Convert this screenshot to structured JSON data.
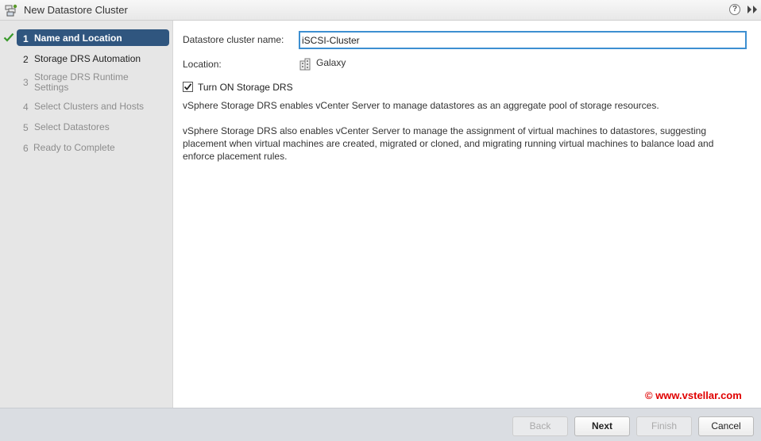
{
  "window": {
    "title": "New Datastore Cluster",
    "title_icon": "datastore-cluster-icon",
    "help_symbol": "?"
  },
  "steps": [
    {
      "number": "1",
      "label": "Name and Location",
      "state": "active",
      "completed": true
    },
    {
      "number": "2",
      "label": "Storage DRS Automation",
      "state": "current"
    },
    {
      "number": "3",
      "label": "Storage DRS Runtime Settings",
      "state": "disabled"
    },
    {
      "number": "4",
      "label": "Select Clusters and Hosts",
      "state": "disabled"
    },
    {
      "number": "5",
      "label": "Select Datastores",
      "state": "disabled"
    },
    {
      "number": "6",
      "label": "Ready to Complete",
      "state": "disabled"
    }
  ],
  "form": {
    "name_label": "Datastore cluster name:",
    "name_value": "iSCSI-Cluster",
    "location_label": "Location:",
    "location_value": "Galaxy",
    "drs_checkbox_label": "Turn ON Storage DRS",
    "drs_checked": true,
    "description_1": "vSphere Storage DRS enables vCenter Server to manage datastores as an aggregate pool of storage resources.",
    "description_2": "vSphere Storage DRS also enables vCenter Server to manage the assignment of virtual machines to datastores, suggesting placement when virtual machines are created, migrated or cloned, and migrating running virtual machines to balance load and enforce placement rules."
  },
  "watermark": "© www.vstellar.com",
  "buttons": {
    "back": "Back",
    "next": "Next",
    "finish": "Finish",
    "cancel": "Cancel"
  },
  "colors": {
    "active_step_bg": "#30567f",
    "input_focus_border": "#3d8fd1",
    "check_green": "#3a9a2c",
    "watermark": "#e00000"
  }
}
